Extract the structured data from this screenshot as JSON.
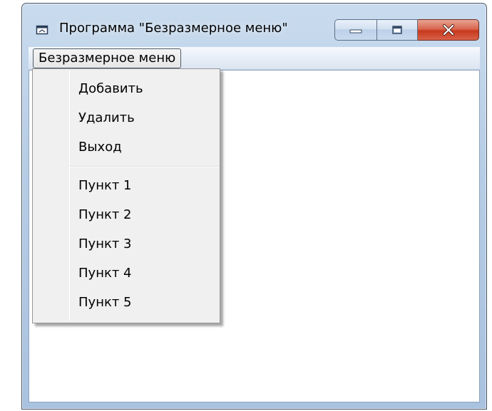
{
  "window": {
    "title": "Программа \"Безразмерное меню\"",
    "icon": "app-window-icon",
    "controls": {
      "minimize_icon": "minimize-icon",
      "maximize_icon": "maximize-icon",
      "close_icon": "close-icon"
    },
    "close_color": "#c7391d"
  },
  "menubar": {
    "items": [
      {
        "label": "Безразмерное меню",
        "open": true
      }
    ]
  },
  "dropdown": {
    "group1": [
      {
        "label": "Добавить"
      },
      {
        "label": "Удалить"
      },
      {
        "label": "Выход"
      }
    ],
    "group2": [
      {
        "label": "Пункт 1"
      },
      {
        "label": "Пункт 2"
      },
      {
        "label": "Пункт 3"
      },
      {
        "label": "Пункт 4"
      },
      {
        "label": "Пункт 5"
      }
    ]
  }
}
